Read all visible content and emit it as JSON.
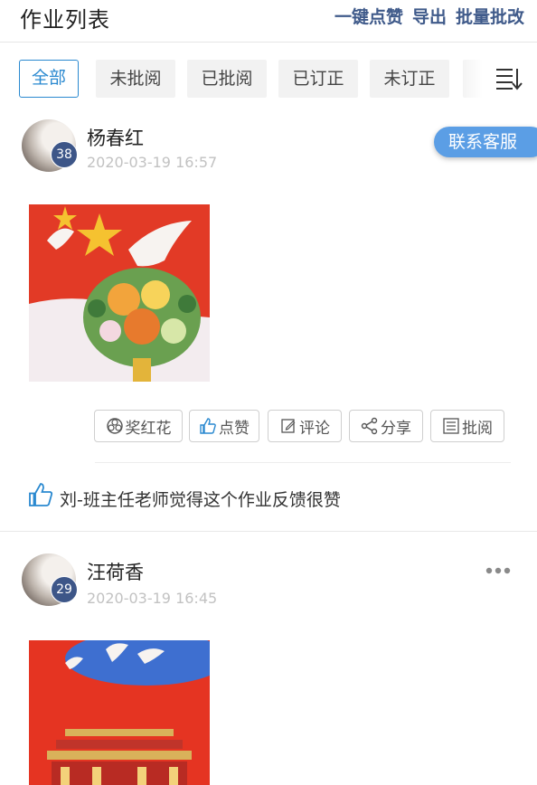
{
  "header": {
    "title": "作业列表",
    "actions": [
      "一键点赞",
      "导出",
      "批量批改"
    ]
  },
  "tabs": [
    {
      "label": "全部",
      "active": true
    },
    {
      "label": "未批阅",
      "active": false
    },
    {
      "label": "已批阅",
      "active": false
    },
    {
      "label": "已订正",
      "active": false
    },
    {
      "label": "未订正",
      "active": false
    }
  ],
  "floating": {
    "contact_label": "联系客服"
  },
  "posts": [
    {
      "author": "杨春红",
      "level": "38",
      "time": "2020-03-19 16:57",
      "actions": [
        "奖红花",
        "点赞",
        "评论",
        "分享",
        "批阅"
      ],
      "like_text": "刘-班主任老师觉得这个作业反馈很赞"
    },
    {
      "author": "汪荷香",
      "level": "29",
      "time": "2020-03-19 16:45"
    }
  ],
  "colors": {
    "accent_blue": "#2a89d0",
    "header_action": "#3f5a8a",
    "badge": "#3d5688",
    "contact_button": "#5b9ee5"
  }
}
